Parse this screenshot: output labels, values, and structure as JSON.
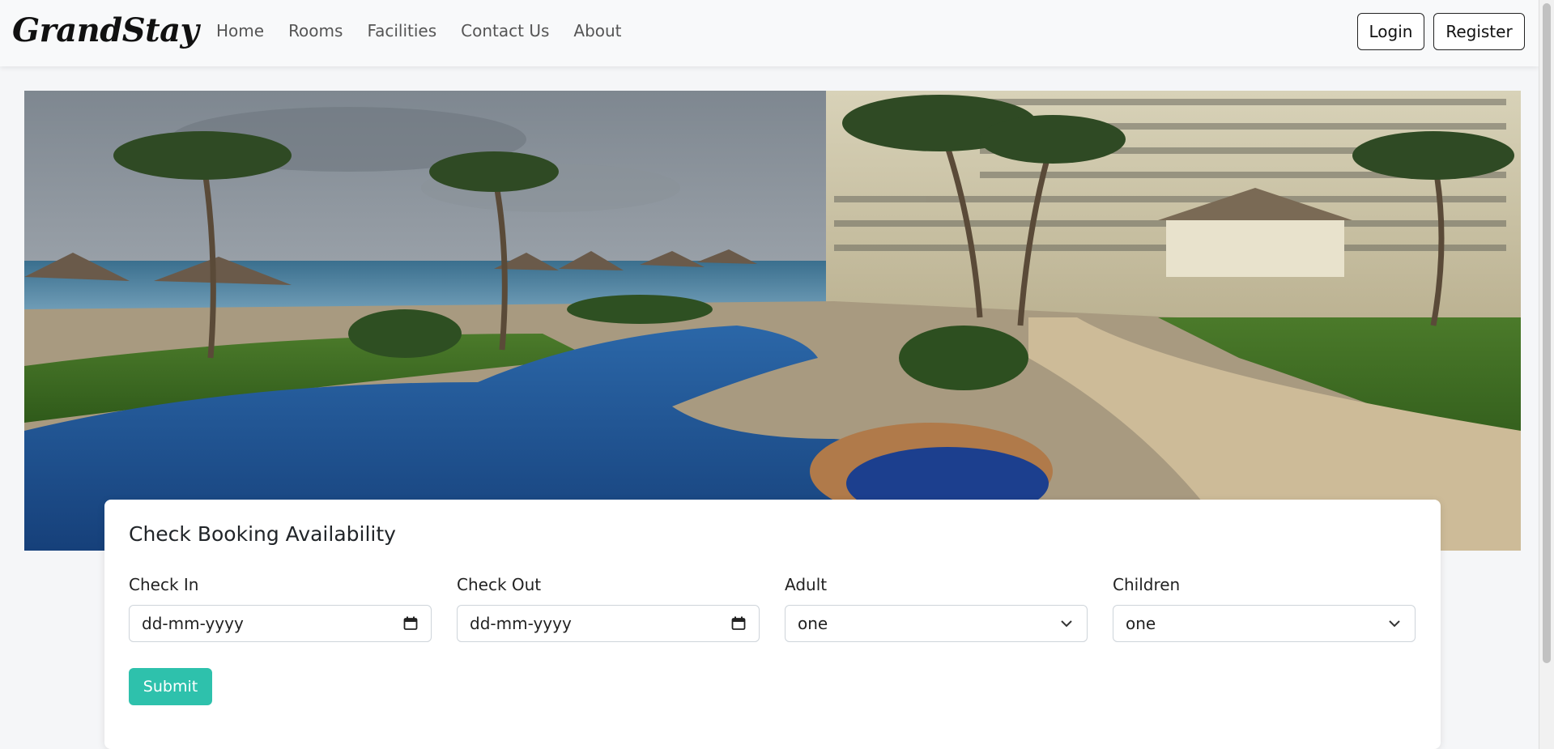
{
  "brand": "GrandStay",
  "nav": {
    "links": [
      "Home",
      "Rooms",
      "Facilities",
      "Contact Us",
      "About"
    ],
    "login_label": "Login",
    "register_label": "Register"
  },
  "hero": {
    "image": "resort-pool-photo"
  },
  "booking": {
    "title": "Check Booking Availability",
    "check_in": {
      "label": "Check In",
      "value": "dd-mm-yyyy"
    },
    "check_out": {
      "label": "Check Out",
      "value": "dd-mm-yyyy"
    },
    "adult": {
      "label": "Adult",
      "value": "one"
    },
    "children": {
      "label": "Children",
      "value": "one"
    },
    "submit_label": "Submit"
  },
  "colors": {
    "accent": "#2ec1ac",
    "navbar_bg": "#f8f9fa",
    "page_bg": "#f5f6f8"
  },
  "icons": {
    "date_picker": "calendar-icon",
    "select": "chevron-down-icon"
  }
}
